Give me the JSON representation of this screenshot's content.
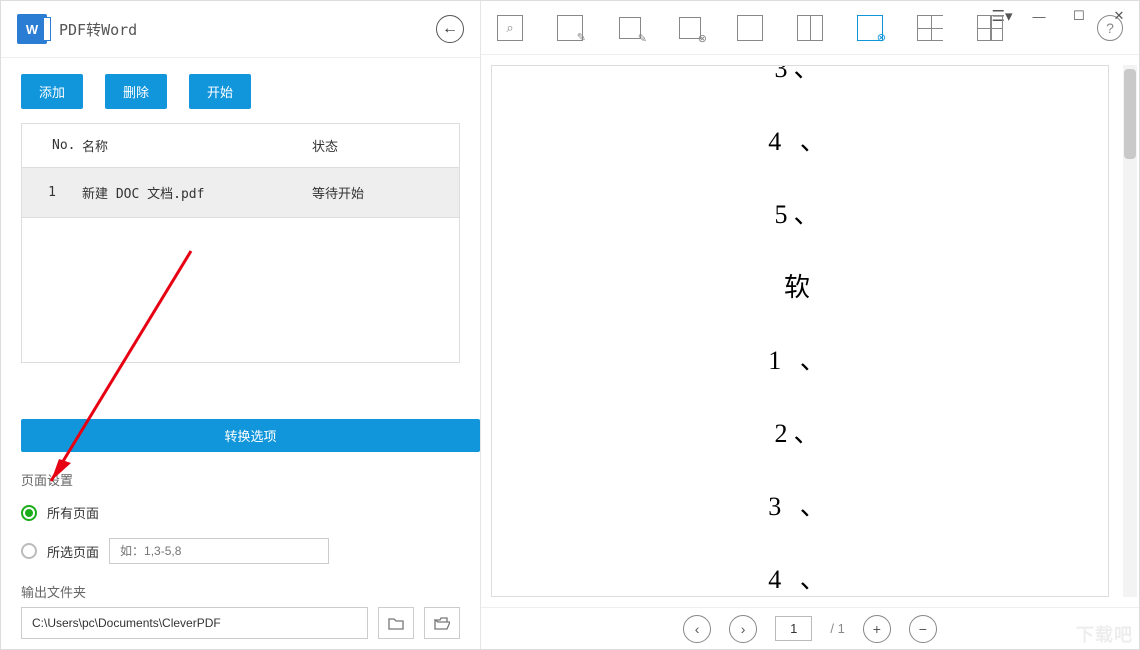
{
  "left": {
    "title": "PDF转Word",
    "buttons": {
      "add": "添加",
      "delete": "删除",
      "start": "开始"
    },
    "table": {
      "headers": {
        "no": "No.",
        "name": "名称",
        "status": "状态"
      },
      "rows": [
        {
          "no": "1",
          "name": "新建 DOC 文档.pdf",
          "status": "等待开始"
        }
      ]
    },
    "options_btn": "转换选项",
    "page_settings": {
      "title": "页面设置",
      "all_pages": "所有页面",
      "selected_pages": "所选页面",
      "range_placeholder": "如：1,3-5,8"
    },
    "output": {
      "label": "输出文件夹",
      "path": "C:\\Users\\pc\\Documents\\CleverPDF"
    }
  },
  "right": {
    "preview_lines": [
      "3、",
      "4 、",
      "5、",
      "软",
      "1 、",
      "2、",
      "3 、",
      "4 、"
    ],
    "pager": {
      "current": "1",
      "total": "/  1"
    }
  },
  "watermark": "下载吧"
}
